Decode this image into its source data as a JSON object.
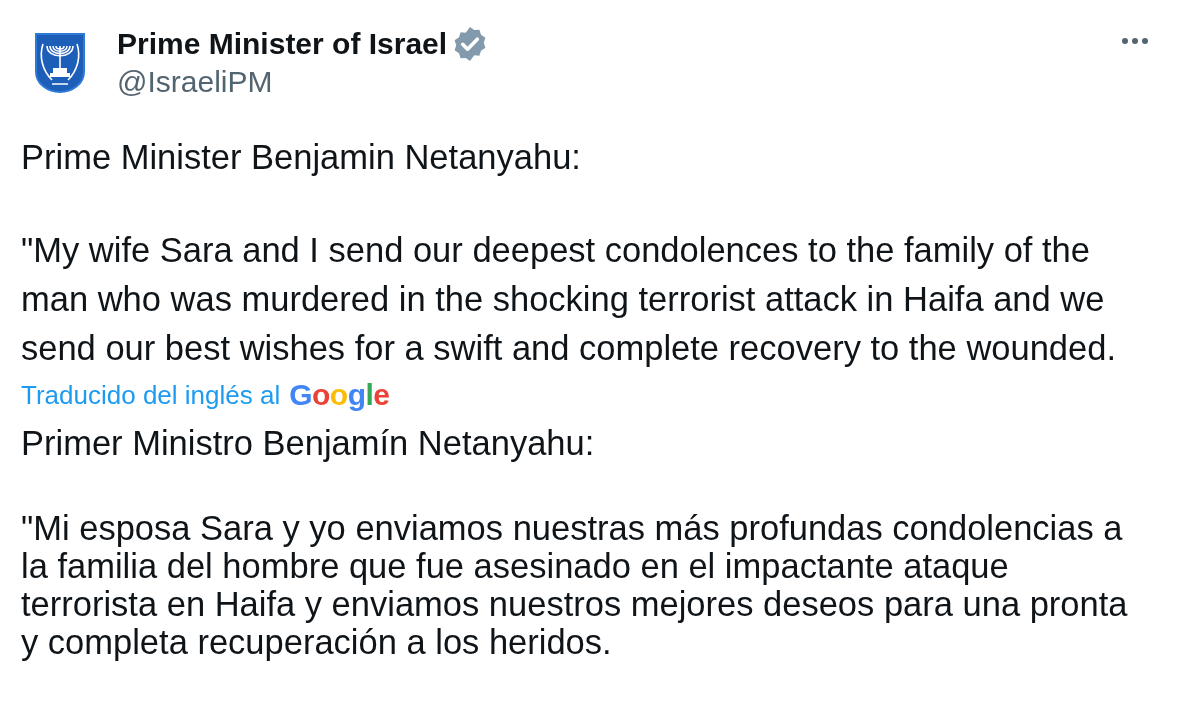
{
  "author": {
    "name": "Prime Minister of Israel",
    "verified": true,
    "handle": "@IsraeliPM"
  },
  "post": {
    "paragraphs": [
      "Prime Minister Benjamin Netanyahu:",
      "\"My wife Sara and I send our deepest condolences to the family of the man who was murdered in the shocking terrorist attack in Haifa and we send our best wishes for a swift and complete recovery to the wounded."
    ]
  },
  "translation": {
    "label": "Traducido del inglés al",
    "provider": "Google",
    "paragraphs": [
      "Primer Ministro Benjamín Netanyahu:",
      "\"Mi esposa Sara y yo enviamos nuestras más profundas condolencias a la familia del hombre que fue asesinado en el impactante ataque terrorista en Haifa y enviamos nuestros mejores deseos para una pronta y completa recuperación a los heridos."
    ]
  }
}
